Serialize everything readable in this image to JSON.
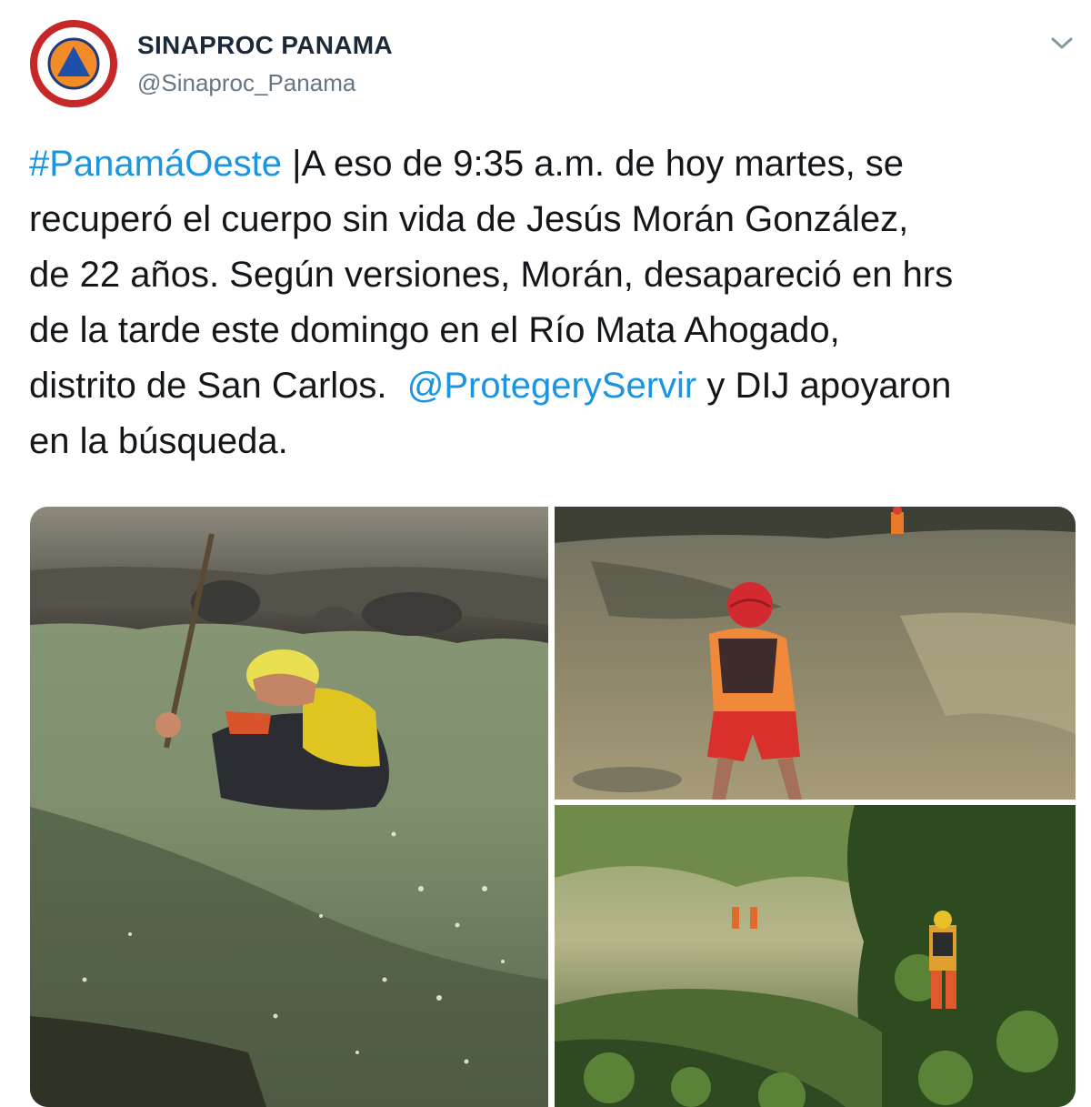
{
  "tweet": {
    "display_name": "SINAPROC PANAMA",
    "handle": "@Sinaproc_Panama",
    "avatar_icon": "civil-protection-logo",
    "menu_icon": "chevron-down-icon",
    "text": {
      "hashtag": "#PanamáOeste",
      "line1_rest": " |A eso de 9:35 a.m. de hoy martes, se",
      "line2": "recuperó el cuerpo sin vida de Jesús Morán González,",
      "line3": "de 22 años. Según versiones, Morán, desapareció en hrs",
      "line4": "de la tarde este domingo en el Río Mata Ahogado,",
      "line5_start": "distrito de San Carlos.  ",
      "mention": "@ProtegerySer vir",
      "line5_end": " y DIJ apoyaron",
      "line6": "en la búsqueda."
    },
    "colors": {
      "link": "#1b95e0",
      "text": "#14171a",
      "handle": "#657786",
      "avatar_ring": "#c62828"
    },
    "media": [
      {
        "description_icon": "photo-rescuer-in-river"
      },
      {
        "description_icon": "photo-rescuer-wading-river"
      },
      {
        "description_icon": "photo-rescuers-in-forest"
      }
    ]
  }
}
